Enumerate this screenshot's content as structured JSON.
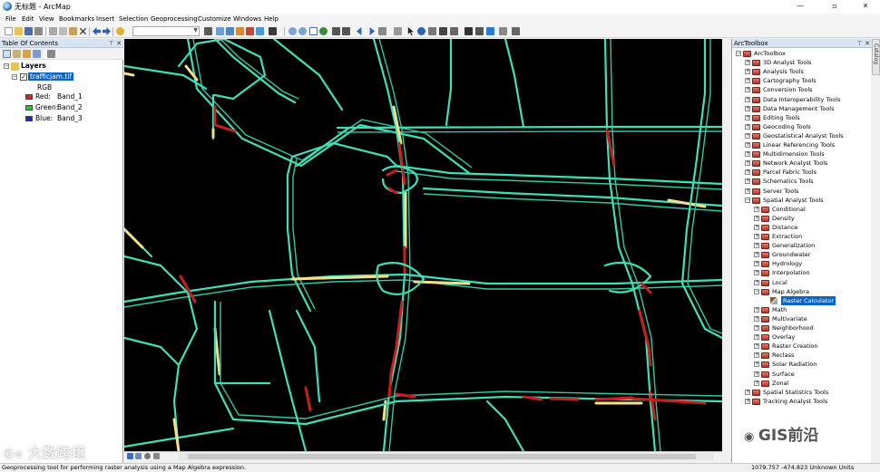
{
  "window": {
    "title": "无标题 - ArcMap",
    "controls": [
      "—",
      "▫",
      "✕"
    ]
  },
  "menubar": [
    "File",
    "Edit",
    "View",
    "Bookmarks",
    "Insert",
    "Selection",
    "Geoprocessing",
    "Customize",
    "Windows",
    "Help"
  ],
  "toc": {
    "title": "Table Of Contents",
    "controls": "⊤ ✕",
    "layers_label": "Layers",
    "layer_name": "trafficjam.tif",
    "rgb_label": "RGB",
    "bands": [
      {
        "channel": "Red:",
        "band": "Band_1",
        "color": "#e02020"
      },
      {
        "channel": "Green:",
        "band": "Band_2",
        "color": "#22cc22"
      },
      {
        "channel": "Blue:",
        "band": "Band_3",
        "color": "#1a2ad0"
      }
    ]
  },
  "arctoolbox": {
    "title": "ArcToolbox",
    "controls": "⊤ ✕",
    "root": "ArcToolbox",
    "toolsets": [
      "3D Analyst Tools",
      "Analysis Tools",
      "Cartography Tools",
      "Conversion Tools",
      "Data Interoperability Tools",
      "Data Management Tools",
      "Editing Tools",
      "Geocoding Tools",
      "Geostatistical Analyst Tools",
      "Linear Referencing Tools",
      "Multidimension Tools",
      "Network Analyst Tools",
      "Parcel Fabric Tools",
      "Schematics Tools",
      "Server Tools",
      "Spatial Analyst Tools"
    ],
    "spatial_analyst_children": [
      "Conditional",
      "Density",
      "Distance",
      "Extraction",
      "Generalization",
      "Groundwater",
      "Hydrology",
      "Interpolation",
      "Local",
      "Map Algebra"
    ],
    "map_algebra_tool": "Raster Calculator",
    "spatial_analyst_children_after": [
      "Math",
      "Multivariate",
      "Neighborhood",
      "Overlay",
      "Raster Creation",
      "Reclass",
      "Solar Radiation",
      "Surface",
      "Zonal"
    ],
    "toolsets_after": [
      "Spatial Statistics Tools",
      "Tracking Analyst Tools"
    ],
    "catalog_tab": "Catalog"
  },
  "statusbar": {
    "message": "Geoprocessing tool for performing raster analysis using a Map Algebra expression.",
    "coordinates": "1079.757  -474.823 Unknown Units"
  },
  "watermarks": {
    "left": "大数跨境",
    "right": "GIS前沿"
  },
  "map": {
    "road_colors": {
      "free": "#3fe0b8",
      "slow": "#f2e08a",
      "jam": "#c81e1e",
      "background": "#000000"
    }
  }
}
